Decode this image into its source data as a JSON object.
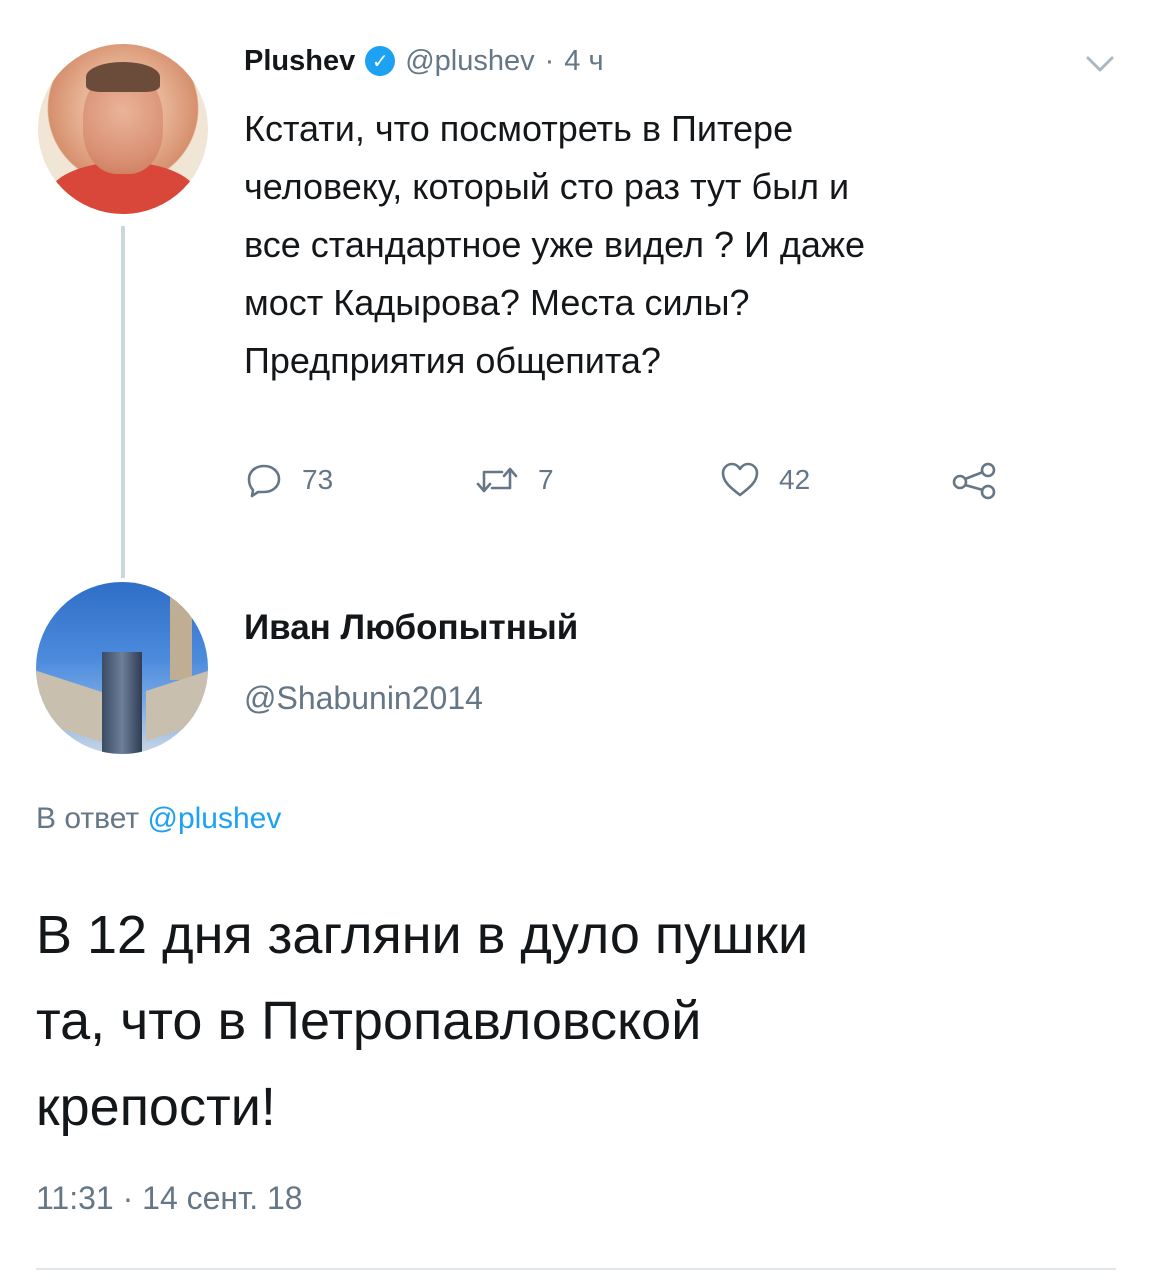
{
  "tweet": {
    "author_name": "Plushev",
    "handle": "@plushev",
    "separator": "·",
    "time": "4 ч",
    "body_lines": [
      "Кстати, что посмотреть в Питере",
      "человеку, который сто раз тут был и",
      "все стандартное уже видел ? И даже",
      "мост Кадырова? Места силы?",
      "Предприятия  общепита?"
    ],
    "actions": {
      "replies": "73",
      "retweets": "7",
      "likes": "42"
    }
  },
  "reply": {
    "author_name": "Иван Любопытный",
    "handle": "@Shabunin2014",
    "in_reply_prefix": "В ответ",
    "in_reply_mention": "@plushev",
    "body_lines": [
      "В 12 дня загляни в дуло пушки",
      "та, что в Петропавловской",
      "крепости!"
    ],
    "timestamp": "11:31 · 14 сент. 18"
  },
  "colors": {
    "text": "#14171a",
    "secondary": "#657786",
    "accent": "#1da1f2",
    "thread_line": "#ccd6dd"
  },
  "icons": {
    "verified": "verified-badge-icon",
    "menu": "chevron-down-icon",
    "reply": "reply-icon",
    "retweet": "retweet-icon",
    "like": "heart-icon",
    "share": "share-icon"
  }
}
